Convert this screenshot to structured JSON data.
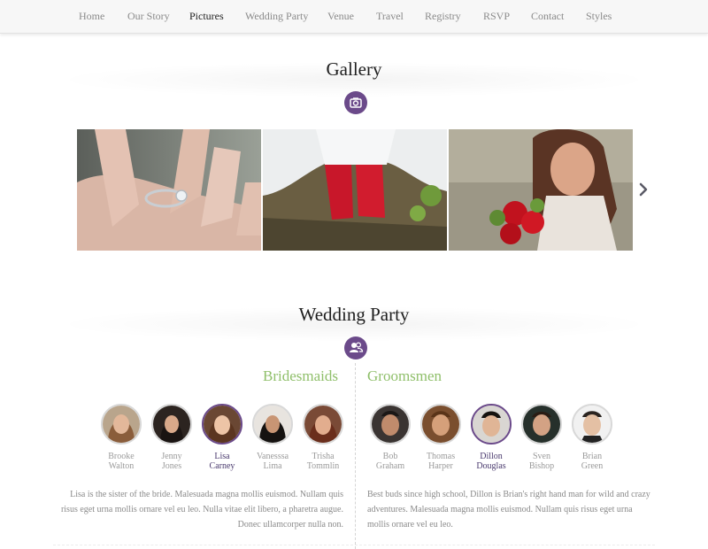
{
  "nav": {
    "items": [
      {
        "label": "Home"
      },
      {
        "label": "Our Story"
      },
      {
        "label": "Pictures"
      },
      {
        "label": "Wedding Party"
      },
      {
        "label": "Venue"
      },
      {
        "label": "Travel"
      },
      {
        "label": "Registry"
      },
      {
        "label": "RSVP"
      },
      {
        "label": "Contact"
      },
      {
        "label": "Styles"
      }
    ],
    "active": "Pictures"
  },
  "gallery": {
    "title": "Gallery",
    "icon": "camera-icon",
    "photos": [
      {
        "icon": "ring-photo"
      },
      {
        "icon": "red-shoes-photo"
      },
      {
        "icon": "bride-with-roses-photo"
      }
    ],
    "next_icon": "chevron-right-icon"
  },
  "party": {
    "title": "Wedding Party",
    "icon": "people-icon",
    "bridesmaids": {
      "title": "Bridesmaids",
      "members": [
        {
          "first": "Brooke",
          "last": "Walton"
        },
        {
          "first": "Jenny",
          "last": "Jones"
        },
        {
          "first": "Lisa",
          "last": "Carney"
        },
        {
          "first": "Vanesssa",
          "last": "Lima"
        },
        {
          "first": "Trisha",
          "last": "Tommlin"
        }
      ],
      "bio": "Lisa is the sister of the bride. Malesuada magna mollis euismod. Nullam quis risus eget urna mollis ornare vel eu leo. Nulla vitae elit libero, a pharetra augue. Donec ullamcorper nulla non."
    },
    "groomsmen": {
      "title": "Groomsmen",
      "members": [
        {
          "first": "Bob",
          "last": "Graham"
        },
        {
          "first": "Thomas",
          "last": "Harper"
        },
        {
          "first": "Dillon",
          "last": "Douglas"
        },
        {
          "first": "Sven",
          "last": "Bishop"
        },
        {
          "first": "Brian",
          "last": "Green"
        }
      ],
      "bio": "Best buds since high school, Dillon is Brian's right hand man for wild and crazy adventures. Malesuada magna mollis euismod. Nullam quis risus eget urna mollis ornare vel eu leo."
    }
  },
  "colors": {
    "accent": "#6b4a8a",
    "green_heading": "#8fbf6a",
    "selected_name": "#4a3a6e"
  }
}
